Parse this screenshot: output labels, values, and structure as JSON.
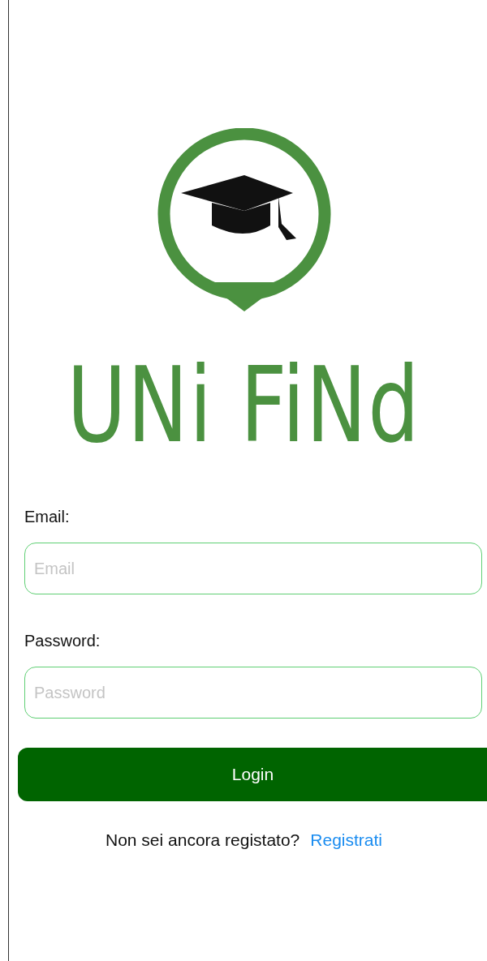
{
  "logo": {
    "text": "UNi FiNd"
  },
  "form": {
    "fields": [
      {
        "label": "Email:",
        "placeholder": "Email"
      },
      {
        "label": "Password:",
        "placeholder": "Password"
      }
    ],
    "submit": "Login"
  },
  "footer": {
    "prompt": "Non sei ancora registato?",
    "link": "Registrati"
  }
}
